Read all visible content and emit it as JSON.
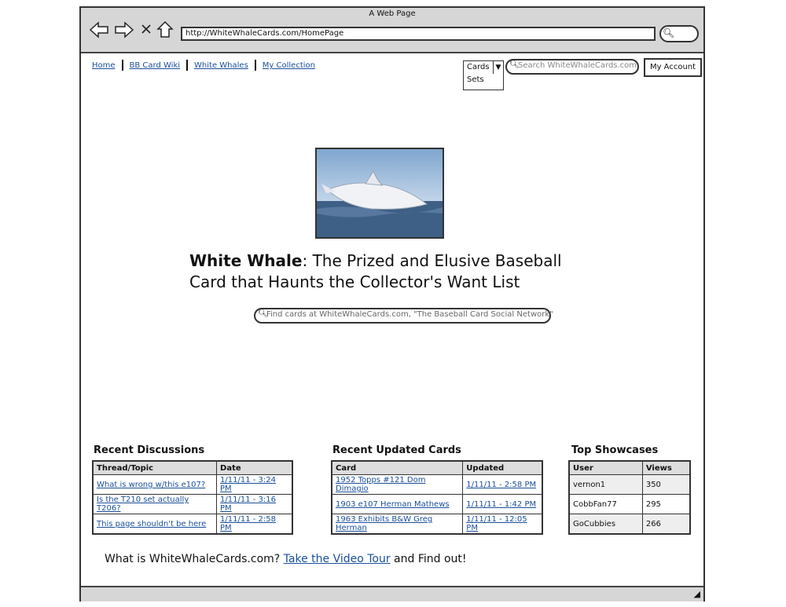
{
  "window": {
    "title": "A Web Page",
    "url": "http://WhiteWhaleCards.com/HomePage"
  },
  "nav": {
    "items": [
      "Home",
      "BB Card Wiki",
      "White Whales",
      "My Collection"
    ]
  },
  "search_bar": {
    "category_selected": "Cards",
    "category_options": [
      "Sets"
    ],
    "placeholder": "Search WhiteWhaleCards.com",
    "account_label": "My Account"
  },
  "hero": {
    "headline_bold": "White Whale",
    "headline_rest": ": The Prized and Elusive Baseball Card that Haunts the Collector's Want List",
    "find_placeholder": "Find cards at WhiteWhaleCards.com, \"The Baseball Card Social Network\""
  },
  "discussions": {
    "title": "Recent Discussions",
    "headers": [
      "Thread/Topic",
      "Date"
    ],
    "rows": [
      [
        "What is wrong w/this e107?",
        "1/11/11 - 3:24 PM"
      ],
      [
        "Is the T210 set actually T206?",
        "1/11/11 - 3:16 PM"
      ],
      [
        "This page shouldn't be here",
        "1/11/11 - 2:58 PM"
      ]
    ]
  },
  "updated_cards": {
    "title": "Recent Updated Cards",
    "headers": [
      "Card",
      "Updated"
    ],
    "rows": [
      [
        "1952 Topps #121 Dom Dimagio",
        "1/11/11 - 2:58 PM"
      ],
      [
        "1903 e107 Herman Mathews",
        "1/11/11 - 1:42 PM"
      ],
      [
        "1963 Exhibits B&W Greg Herman",
        "1/11/11 - 12:05 PM"
      ]
    ]
  },
  "showcases": {
    "title": "Top Showcases",
    "headers": [
      "User",
      "Views"
    ],
    "rows": [
      [
        "vernon1",
        "350"
      ],
      [
        "CobbFan77",
        "295"
      ],
      [
        "GoCubbies",
        "266"
      ]
    ]
  },
  "footer": {
    "prefix": "What is WhiteWhaleCards.com? ",
    "link": "Take the Video Tour",
    "suffix": " and Find out!"
  },
  "icons": [
    "back-arrow-icon",
    "forward-arrow-icon",
    "close-x-icon",
    "home-icon",
    "search-icon",
    "dropdown-arrow-icon",
    "resize-grip-icon",
    "whale-photo"
  ],
  "colors": {
    "link": "#1a4f9a",
    "chrome": "#d6d6d6"
  }
}
